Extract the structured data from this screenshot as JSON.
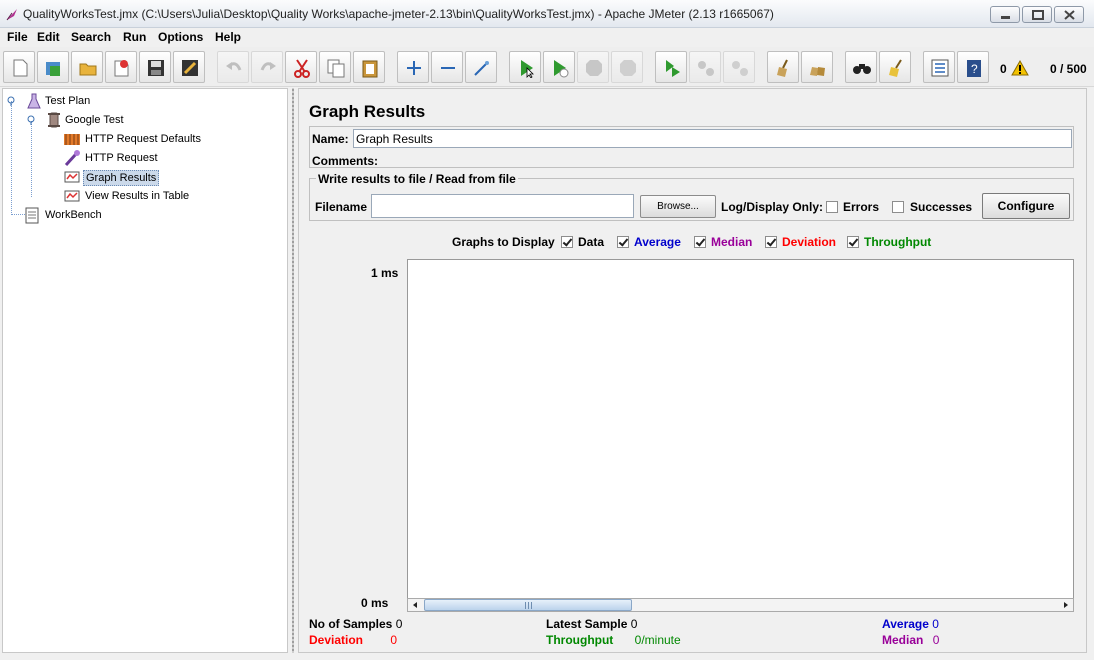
{
  "window": {
    "title": "QualityWorksTest.jmx (C:\\Users\\Julia\\Desktop\\Quality Works\\apache-jmeter-2.13\\bin\\QualityWorksTest.jmx) - Apache JMeter (2.13 r1665067)"
  },
  "menu": [
    "File",
    "Edit",
    "Search",
    "Run",
    "Options",
    "Help"
  ],
  "toolbar": {
    "buttons": [
      "new",
      "templates",
      "open",
      "close",
      "save",
      "save-screenshot",
      "undo",
      "redo",
      "cut",
      "copy",
      "paste",
      "expand-all",
      "collapse-all",
      "toggle",
      "start",
      "start-no-pauses",
      "stop",
      "shutdown",
      "remote-start-all",
      "remote-stop-all",
      "remote-shutdown-all",
      "clear",
      "clear-all",
      "search",
      "reset-search",
      "function-helper",
      "help"
    ],
    "error_count": "0",
    "thread_count": "0 / 500"
  },
  "tree": {
    "test_plan": "Test Plan",
    "thread_group": "Google Test",
    "children": [
      "HTTP Request Defaults",
      "HTTP Request",
      "Graph Results",
      "View Results in Table"
    ],
    "selected": "Graph Results",
    "workbench": "WorkBench"
  },
  "panel": {
    "title": "Graph Results",
    "name_label": "Name:",
    "name_value": "Graph Results",
    "comments_label": "Comments:",
    "file_legend": "Write results to file / Read from file",
    "filename_label": "Filename",
    "browse_label": "Browse...",
    "log_display_label": "Log/Display Only:",
    "errors_label": "Errors",
    "successes_label": "Successes",
    "configure_label": "Configure",
    "graphs_to_display": "Graphs to Display",
    "graph_options": [
      {
        "label": "Data",
        "checked": true,
        "color": "#000000"
      },
      {
        "label": "Average",
        "checked": true,
        "color": "#0000cc"
      },
      {
        "label": "Median",
        "checked": true,
        "color": "#990099"
      },
      {
        "label": "Deviation",
        "checked": true,
        "color": "#ff0000"
      },
      {
        "label": "Throughput",
        "checked": true,
        "color": "#008800"
      }
    ],
    "y_max": "1 ms",
    "y_min": "0 ms",
    "stats": {
      "samples_label": "No of Samples",
      "samples_value": "0",
      "latest_label": "Latest Sample",
      "latest_value": "0",
      "average_label": "Average",
      "average_value": "0",
      "deviation_label": "Deviation",
      "deviation_value": "0",
      "throughput_label": "Throughput",
      "throughput_value": "0/minute",
      "median_label": "Median",
      "median_value": "0"
    }
  }
}
